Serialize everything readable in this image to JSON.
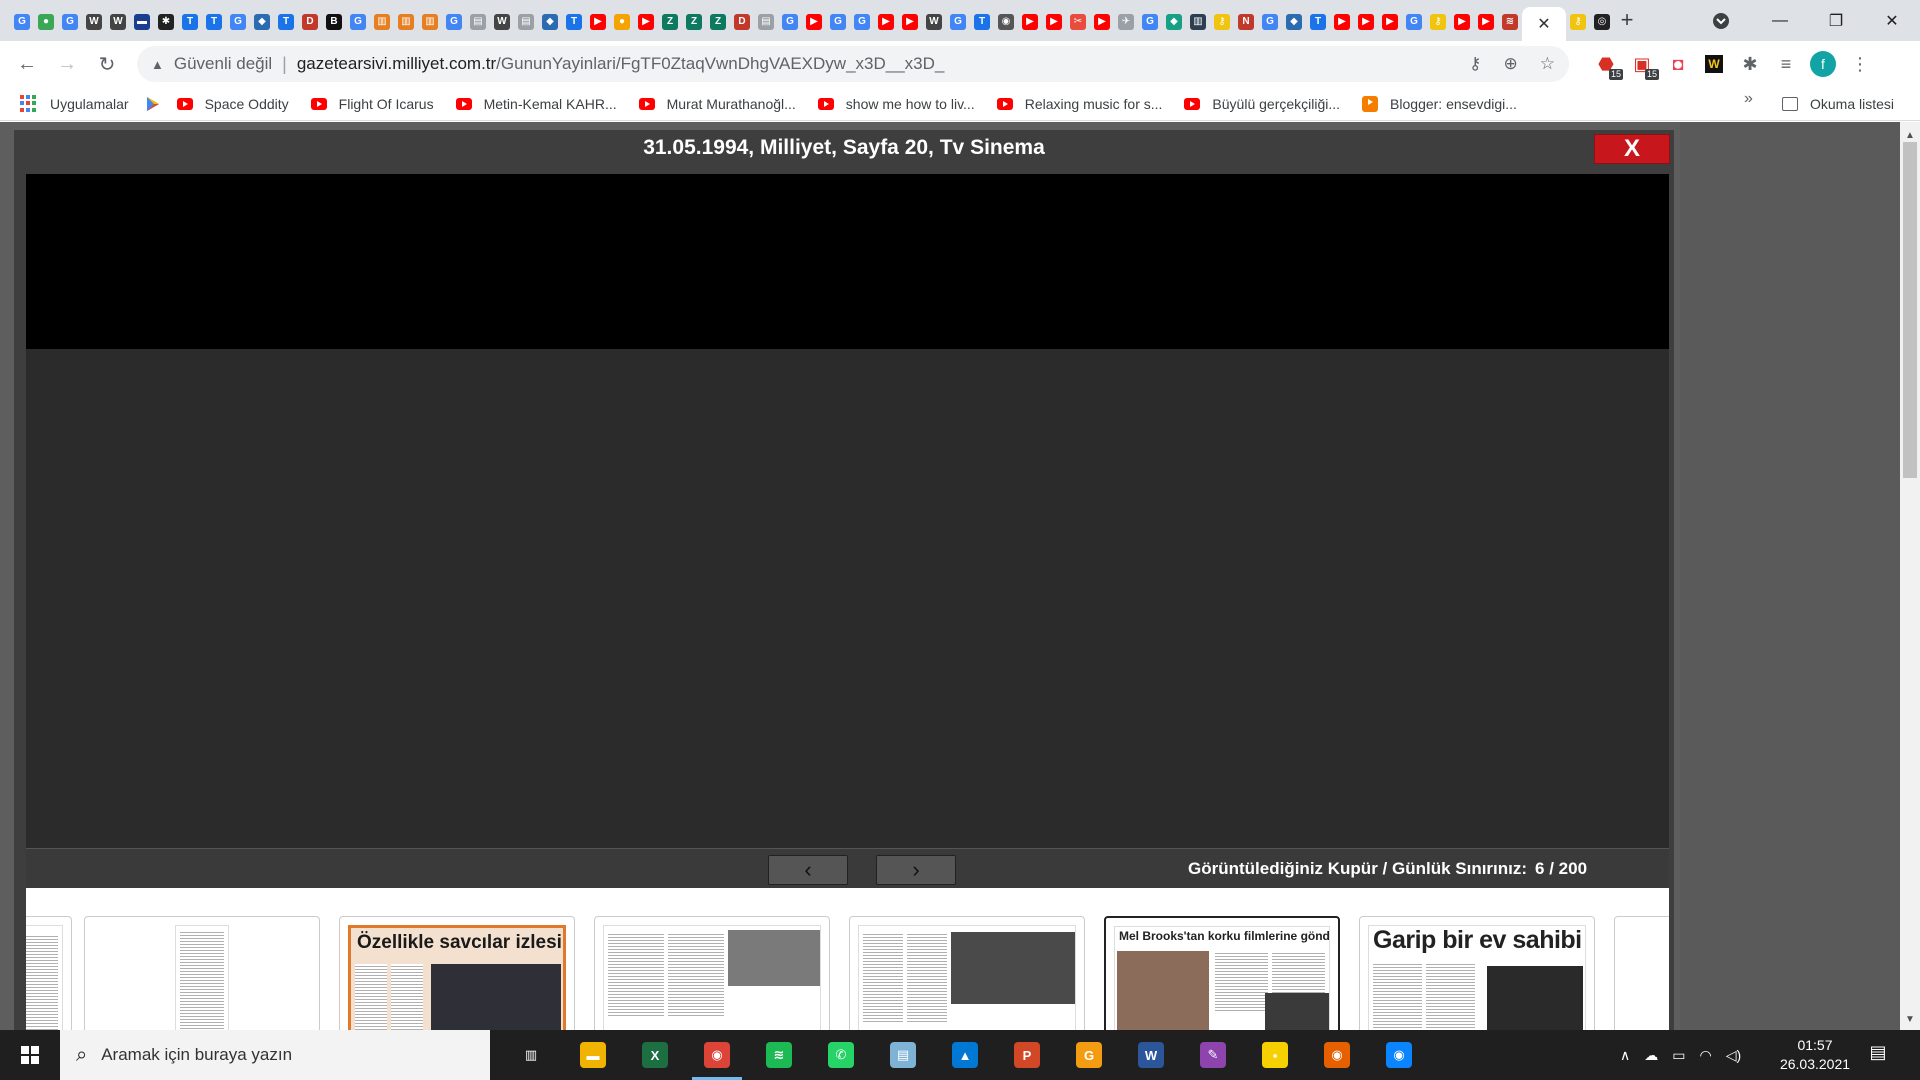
{
  "tabs": {
    "favicons": [
      {
        "icon": "google-icon",
        "glyph": "G",
        "color": "#4285f4"
      },
      {
        "icon": "drop-icon",
        "glyph": "●",
        "color": "#3aa757"
      },
      {
        "icon": "google-icon",
        "glyph": "G",
        "color": "#4285f4"
      },
      {
        "icon": "wikipedia-icon",
        "glyph": "W",
        "color": "#444444"
      },
      {
        "icon": "wikipedia-icon",
        "glyph": "W",
        "color": "#444444"
      },
      {
        "icon": "flag-icon",
        "glyph": "▬",
        "color": "#1a3d8f"
      },
      {
        "icon": "puzzle-icon",
        "glyph": "✱",
        "color": "#222222"
      },
      {
        "icon": "t24-icon",
        "glyph": "T",
        "color": "#1a73e8"
      },
      {
        "icon": "t24-icon",
        "glyph": "T",
        "color": "#1a73e8"
      },
      {
        "icon": "google-icon",
        "glyph": "G",
        "color": "#4285f4"
      },
      {
        "icon": "cloud-icon",
        "glyph": "◆",
        "color": "#2b6cb0"
      },
      {
        "icon": "t24-icon",
        "glyph": "T",
        "color": "#1a73e8"
      },
      {
        "icon": "dp-icon",
        "glyph": "D",
        "color": "#c0392b"
      },
      {
        "icon": "b-icon",
        "glyph": "B",
        "color": "#111111"
      },
      {
        "icon": "google-icon",
        "glyph": "G",
        "color": "#4285f4"
      },
      {
        "icon": "news-icon",
        "glyph": "▥",
        "color": "#e67e22"
      },
      {
        "icon": "news-icon",
        "glyph": "▥",
        "color": "#e67e22"
      },
      {
        "icon": "news-icon",
        "glyph": "▥",
        "color": "#e67e22"
      },
      {
        "icon": "google-icon",
        "glyph": "G",
        "color": "#4285f4"
      },
      {
        "icon": "doc-icon",
        "glyph": "▤",
        "color": "#9aa0a6"
      },
      {
        "icon": "wikipedia-icon",
        "glyph": "W",
        "color": "#444444"
      },
      {
        "icon": "doc-icon",
        "glyph": "▤",
        "color": "#9aa0a6"
      },
      {
        "icon": "cloud-icon",
        "glyph": "◆",
        "color": "#2b6cb0"
      },
      {
        "icon": "t24-icon",
        "glyph": "T",
        "color": "#1a73e8"
      },
      {
        "icon": "youtube-icon",
        "glyph": "▶",
        "color": "#ff0000"
      },
      {
        "icon": "balloon-icon",
        "glyph": "●",
        "color": "#f4a300"
      },
      {
        "icon": "youtube-icon",
        "glyph": "▶",
        "color": "#ff0000"
      },
      {
        "icon": "z-icon",
        "glyph": "Z",
        "color": "#0d7a5f"
      },
      {
        "icon": "z-icon",
        "glyph": "Z",
        "color": "#0d7a5f"
      },
      {
        "icon": "z-icon",
        "glyph": "Z",
        "color": "#0d7a5f"
      },
      {
        "icon": "dp-icon",
        "glyph": "D",
        "color": "#c0392b"
      },
      {
        "icon": "doc-icon",
        "glyph": "▤",
        "color": "#9aa0a6"
      },
      {
        "icon": "google-icon",
        "glyph": "G",
        "color": "#4285f4"
      },
      {
        "icon": "youtube-icon",
        "glyph": "▶",
        "color": "#ff0000"
      },
      {
        "icon": "google-icon",
        "glyph": "G",
        "color": "#4285f4"
      },
      {
        "icon": "google-icon",
        "glyph": "G",
        "color": "#4285f4"
      },
      {
        "icon": "youtube-icon",
        "glyph": "▶",
        "color": "#ff0000"
      },
      {
        "icon": "youtube-icon",
        "glyph": "▶",
        "color": "#ff0000"
      },
      {
        "icon": "wikipedia-icon",
        "glyph": "W",
        "color": "#444444"
      },
      {
        "icon": "google-icon",
        "glyph": "G",
        "color": "#4285f4"
      },
      {
        "icon": "t24-icon",
        "glyph": "T",
        "color": "#1a73e8"
      },
      {
        "icon": "globe-icon",
        "glyph": "◉",
        "color": "#555555"
      },
      {
        "icon": "youtube-icon",
        "glyph": "▶",
        "color": "#ff0000"
      },
      {
        "icon": "youtube-icon",
        "glyph": "▶",
        "color": "#ff0000"
      },
      {
        "icon": "scissors-icon",
        "glyph": "✂",
        "color": "#e74c3c"
      },
      {
        "icon": "youtube-icon",
        "glyph": "▶",
        "color": "#ff0000"
      },
      {
        "icon": "bird-icon",
        "glyph": "✈",
        "color": "#9aa0a6"
      },
      {
        "icon": "google-icon",
        "glyph": "G",
        "color": "#4285f4"
      },
      {
        "icon": "diamond-icon",
        "glyph": "◆",
        "color": "#16a085"
      },
      {
        "icon": "library-icon",
        "glyph": "▥",
        "color": "#2c3e50"
      },
      {
        "icon": "key-icon",
        "glyph": "⚷",
        "color": "#f1c40f"
      },
      {
        "icon": "nk-icon",
        "glyph": "N",
        "color": "#c0392b"
      },
      {
        "icon": "google-icon",
        "glyph": "G",
        "color": "#4285f4"
      },
      {
        "icon": "cloud-icon",
        "glyph": "◆",
        "color": "#2b6cb0"
      },
      {
        "icon": "t24-icon",
        "glyph": "T",
        "color": "#1a73e8"
      },
      {
        "icon": "youtube-icon",
        "glyph": "▶",
        "color": "#ff0000"
      },
      {
        "icon": "youtube-icon",
        "glyph": "▶",
        "color": "#ff0000"
      },
      {
        "icon": "youtube-icon",
        "glyph": "▶",
        "color": "#ff0000"
      },
      {
        "icon": "google-icon",
        "glyph": "G",
        "color": "#4285f4"
      },
      {
        "icon": "key-icon",
        "glyph": "⚷",
        "color": "#f1c40f"
      },
      {
        "icon": "youtube-icon",
        "glyph": "▶",
        "color": "#ff0000"
      },
      {
        "icon": "youtube-icon",
        "glyph": "▶",
        "color": "#ff0000"
      },
      {
        "icon": "flame-icon",
        "glyph": "≋",
        "color": "#c0392b"
      }
    ],
    "active_close": "✕",
    "after_active": [
      {
        "icon": "key-icon",
        "glyph": "⚷",
        "color": "#f1c40f"
      },
      {
        "icon": "github-icon",
        "glyph": "◎",
        "color": "#222222"
      }
    ],
    "new_tab": "+"
  },
  "toolbar": {
    "security_label": "Güvenli değil",
    "url_host": "gazetearsivi.milliyet.com.tr",
    "url_path": "/GununYayinlari/FgTF0ZtaqVwnDhgVAEXDyw_x3D__x3D_",
    "badge_count_1": "15",
    "badge_count_2": "15",
    "profile_initial": "f"
  },
  "bookmarks": {
    "apps_label": "Uygulamalar",
    "items": [
      {
        "label": "Space Oddity"
      },
      {
        "label": "Flight Of Icarus"
      },
      {
        "label": "Metin-Kemal KAHR..."
      },
      {
        "label": "Murat Murathanoğl..."
      },
      {
        "label": "show me how to liv..."
      },
      {
        "label": "Relaxing music for s..."
      },
      {
        "label": "Büyülü gerçekçiliği..."
      },
      {
        "label": "Blogger: ensevdigi..."
      }
    ],
    "more": "»",
    "reading_list": "Okuma listesi"
  },
  "viewer": {
    "title": "31.05.1994, Milliyet, Sayfa 20, Tv Sinema",
    "close_label": "X",
    "prev_label": "‹",
    "next_label": "›",
    "counter_label": "Görüntülediğiniz Kupür / Günlük Sınırınız:",
    "counter_value": "6 / 200"
  },
  "thumbnails": [
    {
      "headline": "Özellikle savcılar izlesin!",
      "selected": false
    },
    {
      "headline": "",
      "selected": false
    },
    {
      "headline": "",
      "selected": false
    },
    {
      "headline": "Mel Brooks'tan korku filmlerine gönderme",
      "selected": true
    },
    {
      "headline": "Garip bir ev sahibi",
      "selected": false
    }
  ],
  "taskbar": {
    "search_placeholder": "Aramak için buraya yazın",
    "apps": [
      {
        "icon": "task-view-icon",
        "glyph": "▥",
        "color": "#1f1f1f"
      },
      {
        "icon": "file-explorer-icon",
        "glyph": "▬",
        "color": "#f0b400"
      },
      {
        "icon": "excel-icon",
        "glyph": "X",
        "color": "#1d6f42"
      },
      {
        "icon": "chrome-icon",
        "glyph": "◉",
        "color": "#db4437",
        "active": true
      },
      {
        "icon": "spotify-icon",
        "glyph": "≋",
        "color": "#1db954"
      },
      {
        "icon": "whatsapp-icon",
        "glyph": "✆",
        "color": "#25d366"
      },
      {
        "icon": "notepad-icon",
        "glyph": "▤",
        "color": "#7fb3d5"
      },
      {
        "icon": "photos-icon",
        "glyph": "▲",
        "color": "#0078d4"
      },
      {
        "icon": "powerpoint-icon",
        "glyph": "P",
        "color": "#d24726"
      },
      {
        "icon": "g-app-icon",
        "glyph": "G",
        "color": "#f39c12"
      },
      {
        "icon": "word-icon",
        "glyph": "W",
        "color": "#2b579a"
      },
      {
        "icon": "paint-icon",
        "glyph": "✎",
        "color": "#8e44ad"
      },
      {
        "icon": "sticky-notes-icon",
        "glyph": "▪",
        "color": "#f7d000"
      },
      {
        "icon": "firefox-icon",
        "glyph": "◉",
        "color": "#e66000"
      },
      {
        "icon": "firefox-dev-icon",
        "glyph": "◉",
        "color": "#0a84ff"
      }
    ],
    "time": "01:57",
    "date": "26.03.2021"
  }
}
